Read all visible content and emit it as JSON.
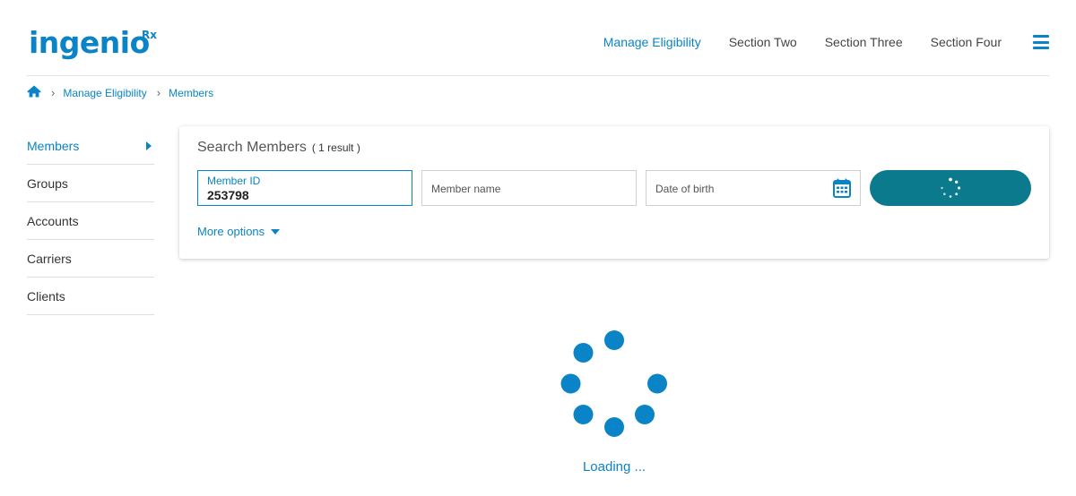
{
  "brand": {
    "logo_text": "ingenio",
    "logo_superscript": "Rx",
    "accent_color": "#0a84c6",
    "button_color": "#0a7a8c"
  },
  "nav": {
    "items": [
      {
        "label": "Manage Eligibility",
        "active": true
      },
      {
        "label": "Section Two"
      },
      {
        "label": "Section Three"
      },
      {
        "label": "Section Four"
      }
    ],
    "menu_icon": "hamburger-menu-icon"
  },
  "breadcrumb": {
    "home_icon": "home-icon",
    "items": [
      "Manage Eligibility",
      "Members"
    ]
  },
  "sidebar": {
    "items": [
      {
        "label": "Members",
        "active": true
      },
      {
        "label": "Groups"
      },
      {
        "label": "Accounts"
      },
      {
        "label": "Carriers"
      },
      {
        "label": "Clients"
      }
    ]
  },
  "search": {
    "title": "Search Members",
    "result_count": "( 1 result )",
    "member_id": {
      "label": "Member ID",
      "value": "253798"
    },
    "member_name": {
      "placeholder": "Member name"
    },
    "date_of_birth": {
      "placeholder": "Date of birth",
      "icon": "calendar-icon"
    },
    "submit_state": "loading",
    "more_options": "More options"
  },
  "loading": {
    "text": "Loading ..."
  }
}
